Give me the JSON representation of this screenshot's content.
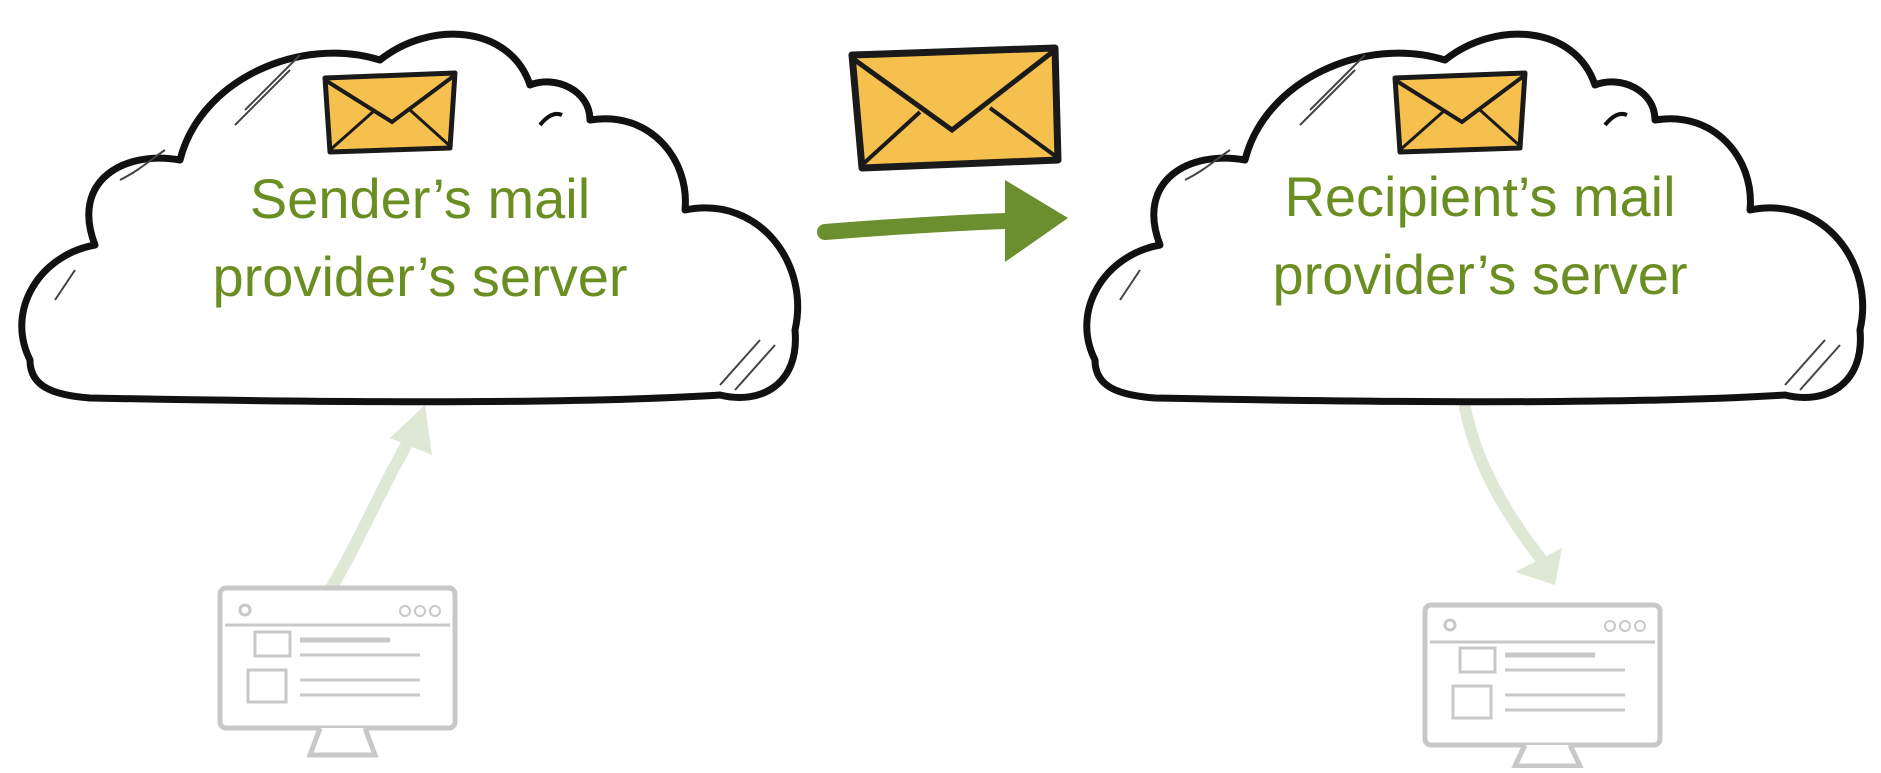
{
  "diagram": {
    "sender_server": {
      "label": "Sender’s mail\nprovider’s server"
    },
    "recipient_server": {
      "label": "Recipient’s mail\nprovider’s server"
    }
  },
  "colors": {
    "label_green": "#6b8e23",
    "arrow_green": "#6b8e2f",
    "faded_arrow_green": "#dfe8d4",
    "envelope_fill": "#f6c04e",
    "envelope_stroke": "#1a1a1a",
    "cloud_stroke": "#111111",
    "monitor_gray": "#c8c8c8"
  },
  "icons": {
    "sender_cloud": "cloud-icon",
    "recipient_cloud": "cloud-icon",
    "envelope": "envelope-icon",
    "computer": "monitor-icon"
  }
}
